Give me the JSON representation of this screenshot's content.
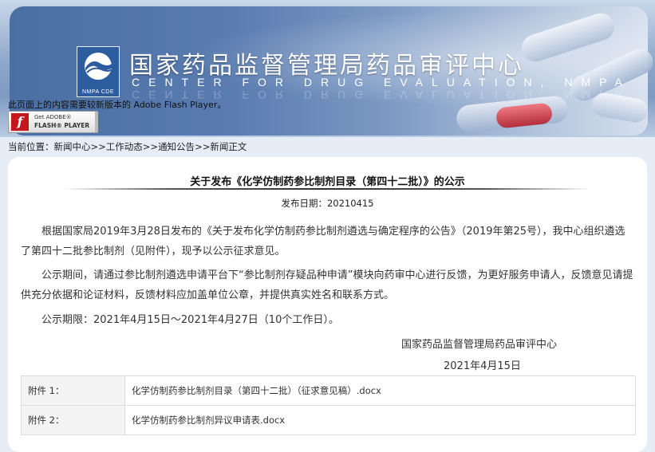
{
  "header": {
    "title_cn": "国家药品监督管理局药品审评中心",
    "title_en": "CENTER FOR DRUG EVALUATION, NMPA",
    "logo_text": "NMPA CDE",
    "flash_notice": "此页面上的内容需要较新版本的 Adobe Flash Player。",
    "flash_button_line1": "Get ADOBE®",
    "flash_button_line2": "FLASH® PLAYER"
  },
  "breadcrumb": {
    "prefix": "当前位置：",
    "items": [
      "新闻中心",
      "工作动态",
      "通知公告",
      "新闻正文"
    ],
    "separator": ">>"
  },
  "article": {
    "title": "关于发布《化学仿制药参比制剂目录（第四十二批）》的公示",
    "publish_date_label": "发布日期：",
    "publish_date": "20210415",
    "paragraphs": [
      "根据国家局2019年3月28日发布的《关于发布化学仿制药参比制剂遴选与确定程序的公告》（2019年第25号），我中心组织遴选了第四十二批参比制剂（见附件），现予以公示征求意见。",
      "公示期间，请通过参比制剂遴选申请平台下“参比制剂存疑品种申请”模块向药审中心进行反馈，为更好服务申请人，反馈意见请提供充分依据和论证材料，反馈材料应加盖单位公章，并提供真实姓名和联系方式。",
      "公示期限：2021年4月15日～2021年4月27日（10个工作日）。"
    ],
    "signature_org": "国家药品监督管理局药品审评中心",
    "signature_date": "2021年4月15日"
  },
  "attachments": [
    {
      "label": "附件 1：",
      "file": "化学仿制药参比制剂目录（第四十二批）（征求意见稿）.docx"
    },
    {
      "label": "附件 2：",
      "file": "化学仿制药参比制剂异议申请表.docx"
    }
  ],
  "colors": {
    "page_bg": "#e6edf6",
    "banner_blue": "#4b6fa3",
    "logo_blue": "#2d5d9f",
    "flash_red": "#c4161c"
  }
}
